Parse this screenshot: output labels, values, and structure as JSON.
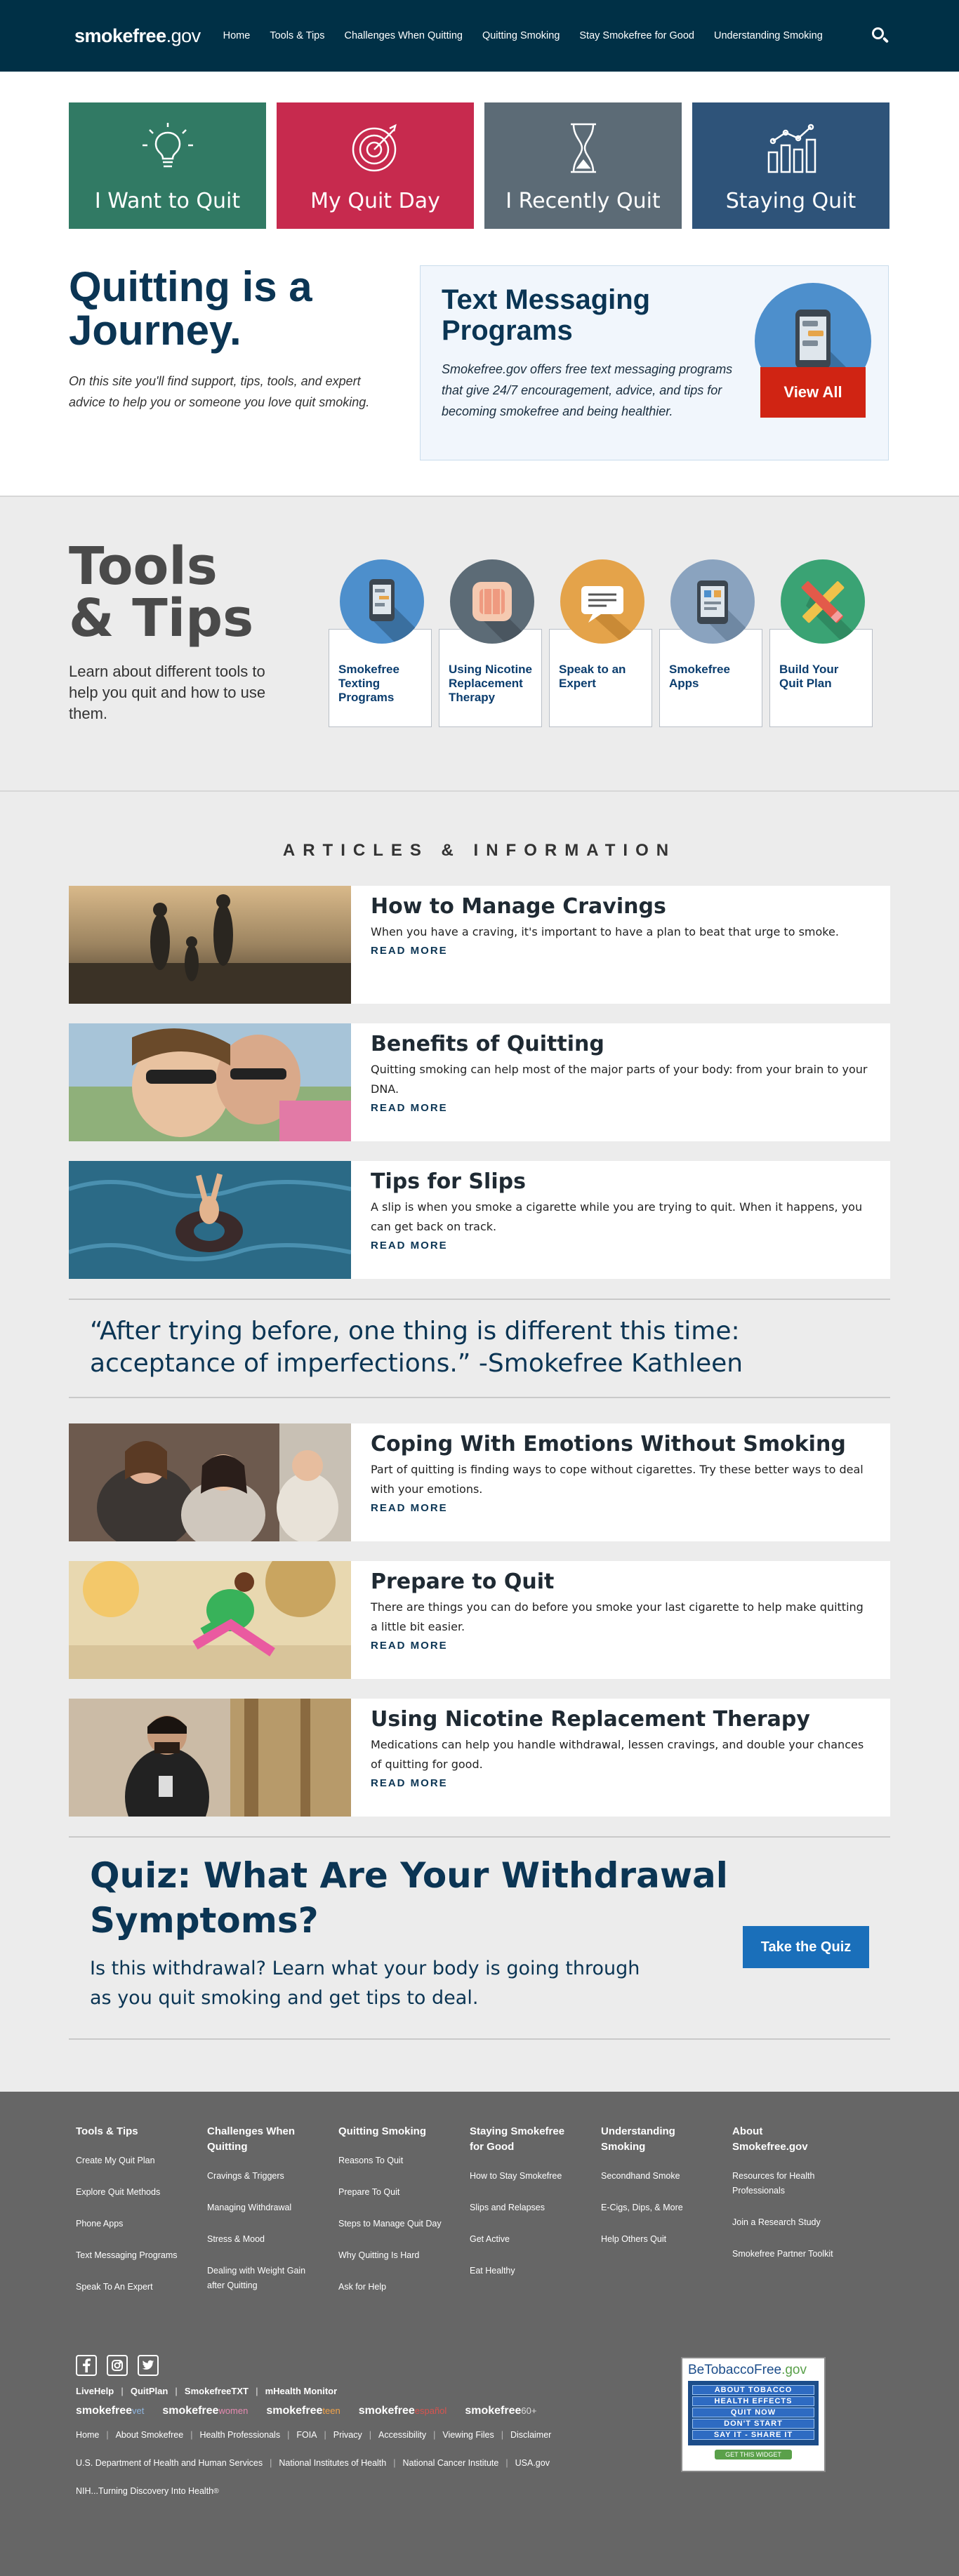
{
  "nav": {
    "logo_main": "smokefree",
    "logo_suffix": ".gov",
    "links": [
      "Home",
      "Tools & Tips",
      "Challenges When Quitting",
      "Quitting Smoking",
      "Stay Smokefree for Good",
      "Understanding Smoking"
    ],
    "search_icon": "search-icon"
  },
  "tiles": [
    {
      "label": "I Want to Quit",
      "icon": "lightbulb-icon",
      "color": "#317a64"
    },
    {
      "label": "My Quit Day",
      "icon": "target-icon",
      "color": "#c72a4e"
    },
    {
      "label": "I Recently Quit",
      "icon": "hourglass-icon",
      "color": "#5c6b76"
    },
    {
      "label": "Staying Quit",
      "icon": "bar-chart-icon",
      "color": "#2e5379"
    }
  ],
  "intro": {
    "title": "Quitting is a Journey.",
    "text": "On this site you'll find support, tips, tools, and expert advice to help you or someone you love quit smoking."
  },
  "promo": {
    "title": "Text Messaging Programs",
    "text": "Smokefree.gov offers free text messaging programs that give 24/7 encouragement, advice, and tips for becoming smokefree and being healthier.",
    "button": "View All"
  },
  "tools": {
    "title_line1": "Tools",
    "title_line2": "& Tips",
    "text": "Learn about different tools to help you quit and how to use them.",
    "cards": [
      {
        "label": "Smokefree Texting Programs",
        "icon": "phone-icon",
        "color": "#4d8fcc"
      },
      {
        "label": "Using Nicotine Replacement Therapy",
        "icon": "nicotine-patch-icon",
        "color": "#5c6b76"
      },
      {
        "label": "Speak to an Expert",
        "icon": "chat-icon",
        "color": "#e4a34a"
      },
      {
        "label": "Smokefree Apps",
        "icon": "tablet-icon",
        "color": "#8aa3bf"
      },
      {
        "label": "Build Your Quit Plan",
        "icon": "pencil-ruler-icon",
        "color": "#3aa374"
      }
    ]
  },
  "articles": {
    "heading": "ARTICLES & INFORMATION",
    "read_more": "READ MORE",
    "items": [
      {
        "title": "How to Manage Cravings",
        "desc": "When you have a craving, it's important to have a plan to beat that urge to smoke."
      },
      {
        "title": "Benefits of Quitting",
        "desc": "Quitting smoking can help most of the major parts of your body: from your brain to your DNA."
      },
      {
        "title": "Tips for Slips",
        "desc": "A slip is when you smoke a cigarette while you are trying to quit. When it happens, you can get back on track."
      }
    ],
    "items2": [
      {
        "title": "Coping With Emotions Without Smoking",
        "desc": "Part of quitting is finding ways to cope without cigarettes. Try these better ways to deal with your emotions."
      },
      {
        "title": "Prepare to Quit",
        "desc": "There are things you can do before you smoke your last cigarette to help make quitting a little bit easier."
      },
      {
        "title": "Using Nicotine Replacement Therapy",
        "desc": "Medications can help you handle withdrawal, lessen cravings, and double your chances of quitting for good."
      }
    ]
  },
  "quote": "“After trying before, one thing is different this time: acceptance of imperfections.” -Smokefree Kathleen",
  "quiz": {
    "title": "Quiz: What Are Your Withdrawal Symptoms?",
    "text": "Is this withdrawal? Learn what your body is going through as you quit smoking and get tips to deal.",
    "button": "Take the Quiz"
  },
  "footer": {
    "columns": [
      {
        "title": "Tools & Tips",
        "links": [
          "Create My Quit Plan",
          "Explore Quit Methods",
          "Phone Apps",
          "Text Messaging Programs",
          "Speak To An Expert"
        ]
      },
      {
        "title": "Challenges When Quitting",
        "links": [
          "Cravings & Triggers",
          "Managing Withdrawal",
          "Stress & Mood",
          "Dealing with Weight Gain after Quitting"
        ]
      },
      {
        "title": "Quitting Smoking",
        "links": [
          "Reasons To Quit",
          "Prepare To Quit",
          "Steps to Manage Quit Day",
          "Why Quitting Is Hard",
          "Ask for Help"
        ]
      },
      {
        "title": "Staying Smokefree for Good",
        "links": [
          "How to Stay Smokefree",
          "Slips and Relapses",
          "Get Active",
          "Eat Healthy"
        ]
      },
      {
        "title": "Understanding Smoking",
        "links": [
          "Secondhand Smoke",
          "E-Cigs, Dips, & More",
          "Help Others Quit"
        ]
      },
      {
        "title": "About Smokefree.gov",
        "links": [
          "Resources for Health Professionals",
          "Join a Research Study",
          "Smokefree Partner Toolkit"
        ]
      }
    ],
    "social": [
      "facebook-icon",
      "instagram-icon",
      "twitter-icon"
    ],
    "program_links": [
      "LiveHelp",
      "QuitPlan",
      "SmokefreeTXT",
      "mHealth Monitor"
    ],
    "brands": [
      {
        "main": "smokefree",
        "sub": "vet"
      },
      {
        "main": "smokefree",
        "sub": "women"
      },
      {
        "main": "smokefree",
        "sub": "teen"
      },
      {
        "main": "smokefree",
        "sub": "español"
      },
      {
        "main": "smokefree",
        "sub": "60+"
      }
    ],
    "site_links": [
      "Home",
      "About Smokefree",
      "Health Professionals",
      "FOIA",
      "Privacy",
      "Accessibility",
      "Viewing Files",
      "Disclaimer"
    ],
    "gov_links": [
      "U.S. Department of Health and Human Services",
      "National Institutes of Health",
      "National Cancer Institute",
      "USA.gov"
    ],
    "nih_tagline": "NIH...Turning Discovery Into Health",
    "widget": {
      "title": "BeTobaccoFree",
      "title_suffix": ".gov",
      "lines": [
        "ABOUT TOBACCO",
        "HEALTH EFFECTS",
        "QUIT NOW",
        "DON'T START",
        "SAY IT - SHARE IT"
      ],
      "cta": "GET THIS WIDGET"
    }
  }
}
